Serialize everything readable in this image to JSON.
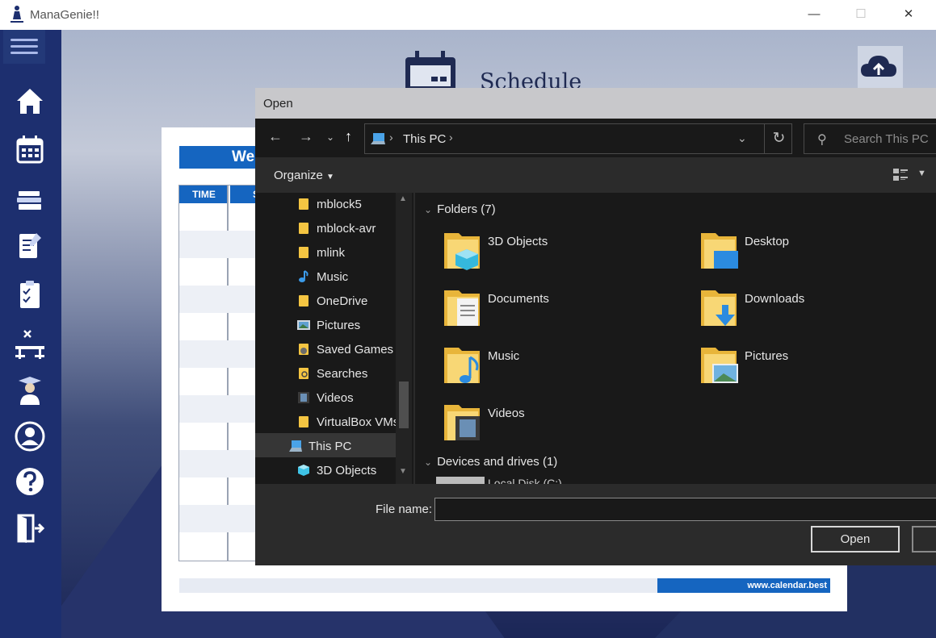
{
  "app": {
    "title": "ManaGenie!!"
  },
  "page": {
    "heading": "Schedule"
  },
  "schedule": {
    "week_label": "We",
    "col_time": "TIME",
    "col_second": "S",
    "footer_url": "www.calendar.best"
  },
  "dialog": {
    "title": "Open",
    "address": {
      "location": "This PC"
    },
    "search_placeholder": "Search This PC",
    "organize_label": "Organize",
    "nav_items": [
      {
        "label": "mblock5",
        "icon": "folder-icon"
      },
      {
        "label": "mblock-avr",
        "icon": "folder-icon"
      },
      {
        "label": "mlink",
        "icon": "folder-icon"
      },
      {
        "label": "Music",
        "icon": "music-note-icon"
      },
      {
        "label": "OneDrive",
        "icon": "folder-icon"
      },
      {
        "label": "Pictures",
        "icon": "pictures-icon"
      },
      {
        "label": "Saved Games",
        "icon": "saved-games-icon"
      },
      {
        "label": "Searches",
        "icon": "search-folder-icon"
      },
      {
        "label": "Videos",
        "icon": "videos-icon"
      },
      {
        "label": "VirtualBox VMs",
        "icon": "folder-icon"
      },
      {
        "label": "This PC",
        "icon": "this-pc-icon"
      },
      {
        "label": "3D Objects",
        "icon": "3d-objects-icon"
      }
    ],
    "folders_header": "Folders (7)",
    "folders": [
      {
        "label": "3D Objects",
        "icon": "3d-objects-folder-icon"
      },
      {
        "label": "Desktop",
        "icon": "desktop-folder-icon"
      },
      {
        "label": "Documents",
        "icon": "documents-folder-icon"
      },
      {
        "label": "Downloads",
        "icon": "downloads-folder-icon"
      },
      {
        "label": "Music",
        "icon": "music-folder-icon"
      },
      {
        "label": "Pictures",
        "icon": "pictures-folder-icon"
      },
      {
        "label": "Videos",
        "icon": "videos-folder-icon"
      }
    ],
    "devices_header": "Devices and drives (1)",
    "devices": [
      {
        "label": "Local Disk (C:)",
        "icon": "drive-icon"
      }
    ],
    "filename_label": "File name:",
    "filename_value": "",
    "open_label": "Open"
  },
  "colors": {
    "sidebar": "#1d2f6f",
    "accent": "#1565c0",
    "dialog_bg": "#191919"
  }
}
